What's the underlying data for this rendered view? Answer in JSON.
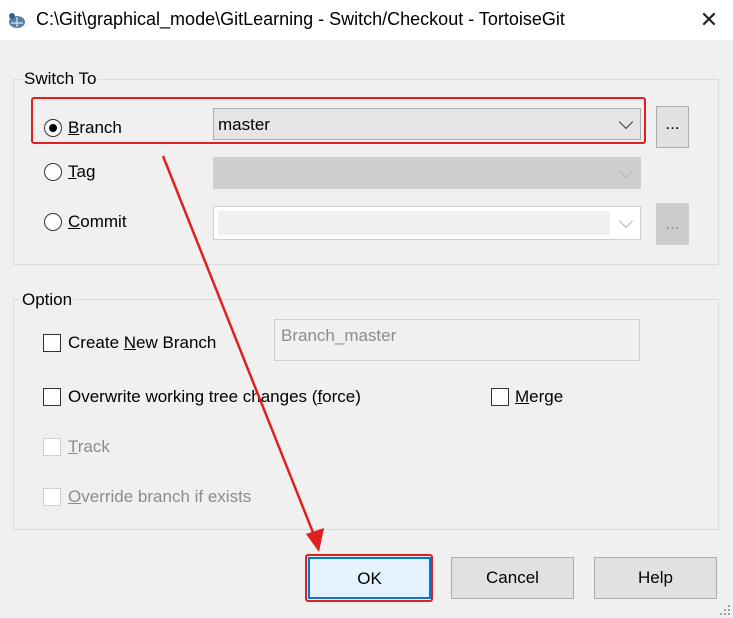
{
  "window": {
    "title": "C:\\Git\\graphical_mode\\GitLearning - Switch/Checkout - TortoiseGit",
    "close_glyph": "✕",
    "icon": "tortoisegit-icon"
  },
  "switch_to": {
    "group_label": "Switch To",
    "branch": {
      "label_first": "B",
      "label_rest": "ranch",
      "selected": true,
      "value": "master"
    },
    "tag": {
      "label_first": "T",
      "label_rest": "ag",
      "selected": false,
      "value": ""
    },
    "commit": {
      "label_first": "C",
      "label_rest": "ommit",
      "selected": false,
      "value": ""
    },
    "browse_label": "..."
  },
  "option": {
    "group_label": "Option",
    "create_new_branch": {
      "pre": "Create ",
      "ul": "N",
      "post": "ew Branch",
      "checked": false,
      "name_value": "Branch_master"
    },
    "overwrite": {
      "pre": "Overwrite working tree changes (",
      "ul": "f",
      "post": "orce)",
      "checked": false
    },
    "merge": {
      "ul": "M",
      "post": "erge",
      "checked": false
    },
    "track": {
      "ul": "T",
      "post": "rack",
      "checked": false,
      "enabled": false
    },
    "override": {
      "ul": "O",
      "post": "verride branch if exists",
      "checked": false,
      "enabled": false
    }
  },
  "buttons": {
    "ok": "OK",
    "cancel": "Cancel",
    "help": "Help"
  },
  "annotation": {
    "color": "#e02020"
  }
}
